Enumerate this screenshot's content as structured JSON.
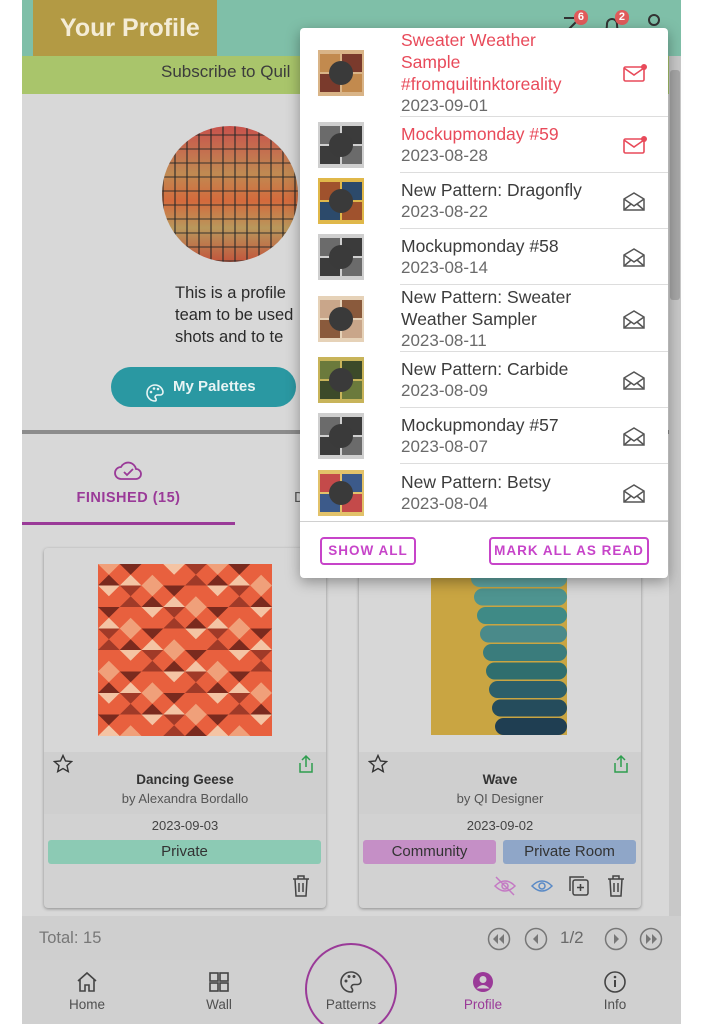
{
  "header": {
    "title": "Your Profile",
    "messages_badge": "6",
    "notifications_badge": "2",
    "subscribe_text": "Subscribe to Quil"
  },
  "profile": {
    "description_lines": [
      "This is a profile",
      "team to be used",
      "shots and to te"
    ],
    "palettes_button": "My Palettes"
  },
  "tabs": {
    "finished_label": "FINISHED (15)",
    "other_label": "D"
  },
  "cards": [
    {
      "name": "Dancing Geese",
      "author": "by Alexandra Bordallo",
      "date": "2023-09-03",
      "tags": [
        "Private"
      ]
    },
    {
      "name": "Wave",
      "author": "by QI Designer",
      "date": "2023-09-02",
      "tags": [
        "Community",
        "Private Room"
      ]
    }
  ],
  "footer": {
    "total": "Total: 15",
    "page": "1/2"
  },
  "nav": {
    "items": [
      {
        "label": "Home",
        "icon": "home-icon"
      },
      {
        "label": "Wall",
        "icon": "grid-icon"
      },
      {
        "label": "Patterns",
        "icon": "palette-icon"
      },
      {
        "label": "Profile",
        "icon": "user-circle-icon"
      },
      {
        "label": "Info",
        "icon": "info-icon"
      }
    ]
  },
  "notifications": {
    "items": [
      {
        "title_lines": [
          "Sweater Weather",
          "Sample",
          "#fromquiltinktoreality"
        ],
        "date": "2023-09-01",
        "unread": true
      },
      {
        "title_lines": [
          "Mockupmonday #59"
        ],
        "date": "2023-08-28",
        "unread": true
      },
      {
        "title_lines": [
          "New Pattern: Dragonfly"
        ],
        "date": "2023-08-22",
        "unread": false
      },
      {
        "title_lines": [
          "Mockupmonday #58"
        ],
        "date": "2023-08-14",
        "unread": false
      },
      {
        "title_lines": [
          "New Pattern: Sweater",
          "Weather Sampler"
        ],
        "date": "2023-08-11",
        "unread": false
      },
      {
        "title_lines": [
          "New Pattern: Carbide"
        ],
        "date": "2023-08-09",
        "unread": false
      },
      {
        "title_lines": [
          "Mockupmonday #57"
        ],
        "date": "2023-08-07",
        "unread": false
      },
      {
        "title_lines": [
          "New Pattern: Betsy"
        ],
        "date": "2023-08-04",
        "unread": false
      }
    ],
    "show_all": "SHOW ALL",
    "mark_all_read": "MARK ALL AS READ"
  },
  "colors": {
    "accent": "#9a3a98",
    "unread": "#e84a5a",
    "header": "#7fbfa8",
    "teal_button": "#2a98a2"
  }
}
